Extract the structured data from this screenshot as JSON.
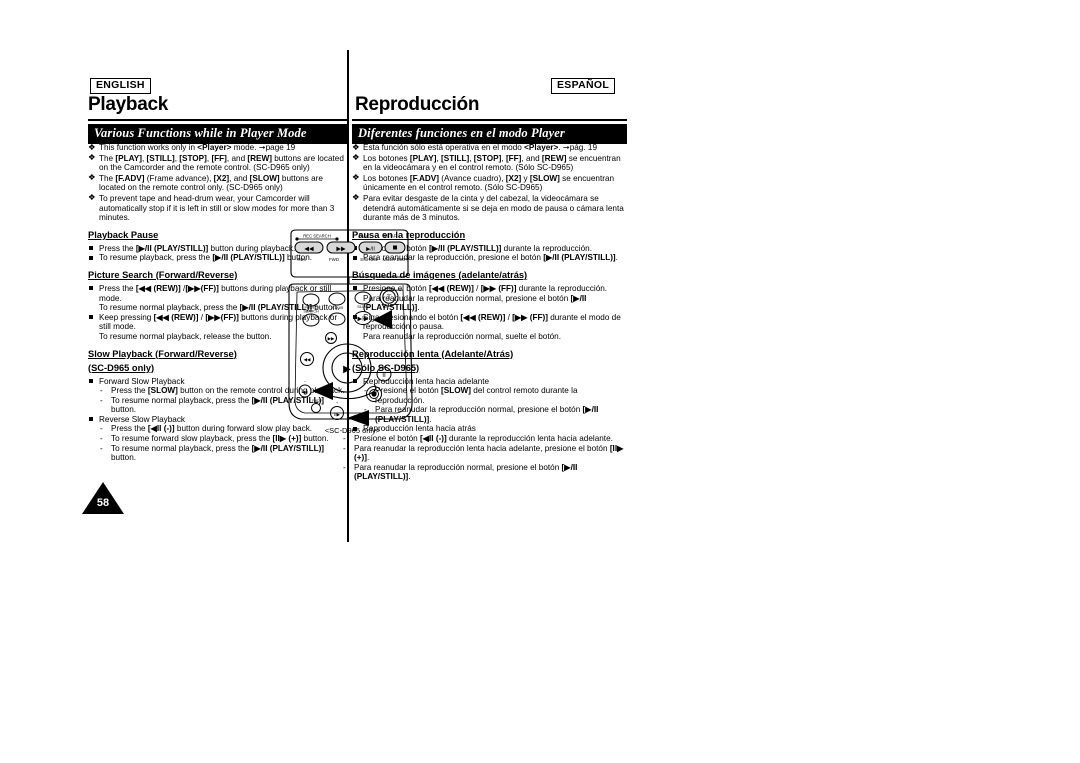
{
  "document": {
    "type": "camcorder-instruction-manual-page",
    "page_number": "58",
    "language_tags": {
      "left": "ENGLISH",
      "right": "ESPAÑOL"
    }
  },
  "left": {
    "title": "Playback",
    "section_bar": "Various Functions while in Player Mode",
    "intro_bullets": [
      "This function works only in <Player> mode. ➡page 19",
      "The [PLAY], [STILL], [STOP], [FF], and [REW] buttons are located on the Camcorder and the remote control. (SC-D965 only)",
      "The [F.ADV] (Frame advance), [X2], and [SLOW] buttons are located on the remote control only. (SC-D965 only)",
      "To prevent tape and head-drum wear, your Camcorder will automatically stop if it is left in still or slow modes for more than 3 minutes."
    ],
    "sections": [
      {
        "heading": "Playback Pause",
        "items": [
          "Press the [▶/II (PLAY/STILL)] button during playback.",
          "To resume playback, press the [▶/II (PLAY/STILL)] button."
        ]
      },
      {
        "heading": "Picture Search (Forward/Reverse)",
        "items": [
          "Press the [◀◀ (REW)] /[▶▶(FF)] buttons during playback or still mode. To resume normal playback, press the [▶/II (PLAY/STILL)] button.",
          "Keep pressing [◀◀ (REW)] / [▶▶(FF)] buttons during playback or still mode. To resume normal playback, release the button."
        ]
      },
      {
        "heading": "Slow Playback (Forward/Reverse)",
        "heading_line2": "(SC-D965 only)",
        "groups": [
          {
            "label": "Forward Slow Playback",
            "steps": [
              "Press the [SLOW] button on the remote control during playback.",
              "To resume normal playback, press the [▶/II (PLAY/STILL)] button."
            ]
          },
          {
            "label": "Reverse Slow Playback",
            "steps": [
              "Press the [◀II (-)] button during forward slow play back.",
              "To resume forward slow playback, press the [II▶ (+)] button.",
              "To resume normal playback, press the [▶/II (PLAY/STILL)] button."
            ]
          }
        ]
      }
    ]
  },
  "right": {
    "title": "Reproducción",
    "section_bar": "Diferentes funciones en el modo Player",
    "intro_bullets": [
      "Esta función sólo está operativa en el modo <Player>. ➡pág. 19",
      "Los botones [PLAY], [STILL], [STOP], [FF], and [REW] se encuentran en la videocámara y en el control remoto. (Sólo SC-D965)",
      "Los botones [F.ADV] (Avance cuadro), [X2] y [SLOW] se encuentran únicamente en el control remoto. (Sólo SC-D965)",
      "Para evitar desgaste de la cinta y del cabezal, la videocámara se detendrá automáticamente si se deja en modo de pausa o cámara lenta durante más de 3 minutos."
    ],
    "sections": [
      {
        "heading": "Pausa en la reproducción",
        "items": [
          "Presione el botón [▶/II (PLAY/STILL)] durante la reproducción.",
          "Para reanudar la reproducción, presione el botón [▶/II (PLAY/STILL)]."
        ]
      },
      {
        "heading": "Búsqueda de imágenes (adelante/atrás)",
        "items": [
          "Presione el botón [◀◀ (REW)] / [▶▶ (FF)] durante la reproducción. Para reanudar la reproducción normal, presione el botón [▶/II (PLAY/STILL)].",
          "Siga presionando el botón [◀◀ (REW)] / [▶▶ (FF)] durante el modo de reproducción o pausa. Para reanudar la reproducción normal, suelte el botón."
        ]
      },
      {
        "heading": "Reproducción lenta (Adelante/Atrás)",
        "heading_line2": "(Sólo SC-D965)",
        "groups": [
          {
            "label": "Reproducción lenta hacia adelante",
            "steps": [
              "Presione el botón [SLOW] del control remoto durante la reproducción.",
              "Para reanudar la reproducción normal, presione el botón [▶/II (PLAY/STILL)]."
            ]
          },
          {
            "label": "Reproducción lenta hacia atrás",
            "steps": [
              "Presione el botón [◀II (-)] durante la reproducción lenta hacia adelante.",
              "Para reanudar la reproducción lenta hacia adelante, presione el botón [II▶ (+)].",
              "Para reanudar la reproducción normal, presione el botón [▶/II (PLAY/STILL)]."
            ]
          }
        ]
      }
    ]
  },
  "illustration": {
    "caption": "<SC-D965 only>",
    "top_panel": {
      "group_labels": [
        "REC SEARCH",
        "FADE",
        "MF/AF"
      ],
      "button_labels": [
        "REV",
        "FWD",
        "S.SHOW",
        "MULTI DISP."
      ],
      "button_glyphs": [
        "◀◀",
        "▶▶",
        "▶/II",
        "■"
      ]
    },
    "body_panel": {
      "row_labels": [
        "PHOTO SEARCH",
        "A.DUB",
        "SLOW"
      ],
      "zoom_label": "T",
      "x2_label": "X2",
      "f_adv_label": "F.ADV",
      "callout_targets": [
        "X2 button",
        "REW / slow-reverse button",
        "F.ADV button"
      ]
    }
  }
}
